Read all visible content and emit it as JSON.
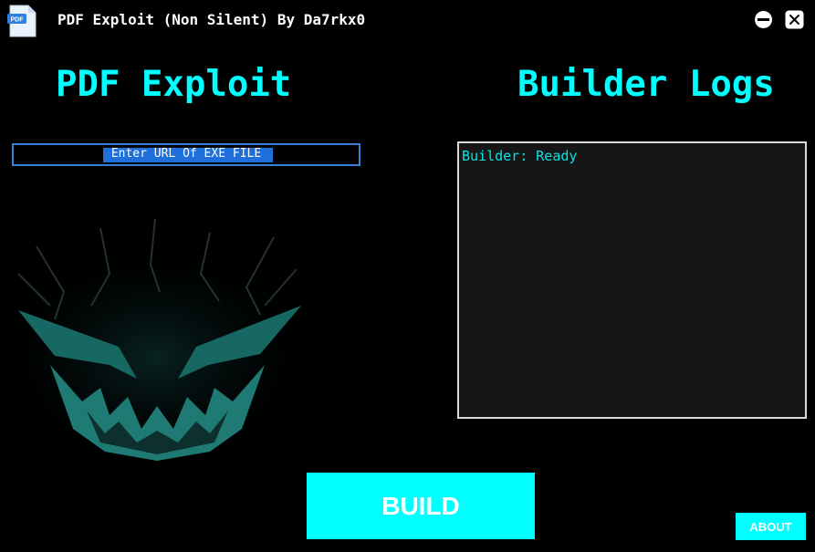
{
  "window": {
    "title": "PDF Exploit (Non Silent) By Da7rkx0",
    "icon_label": "PDF"
  },
  "left_panel": {
    "heading": "PDF Exploit",
    "url_input": {
      "value": "Enter URL Of EXE FILE"
    }
  },
  "right_panel": {
    "heading": "Builder Logs",
    "log_lines": [
      "Builder: Ready"
    ]
  },
  "actions": {
    "build_label": "BUILD",
    "about_label": "ABOUT"
  },
  "colors": {
    "accent": "#00ffff",
    "background": "#000000",
    "log_text": "#00e5e5",
    "log_bg": "#161616",
    "selection": "#1e6fd9"
  },
  "icons": {
    "app": "pdf-file-icon",
    "minimize": "minimize-icon",
    "close": "close-icon",
    "artwork": "demon-face-artwork"
  }
}
